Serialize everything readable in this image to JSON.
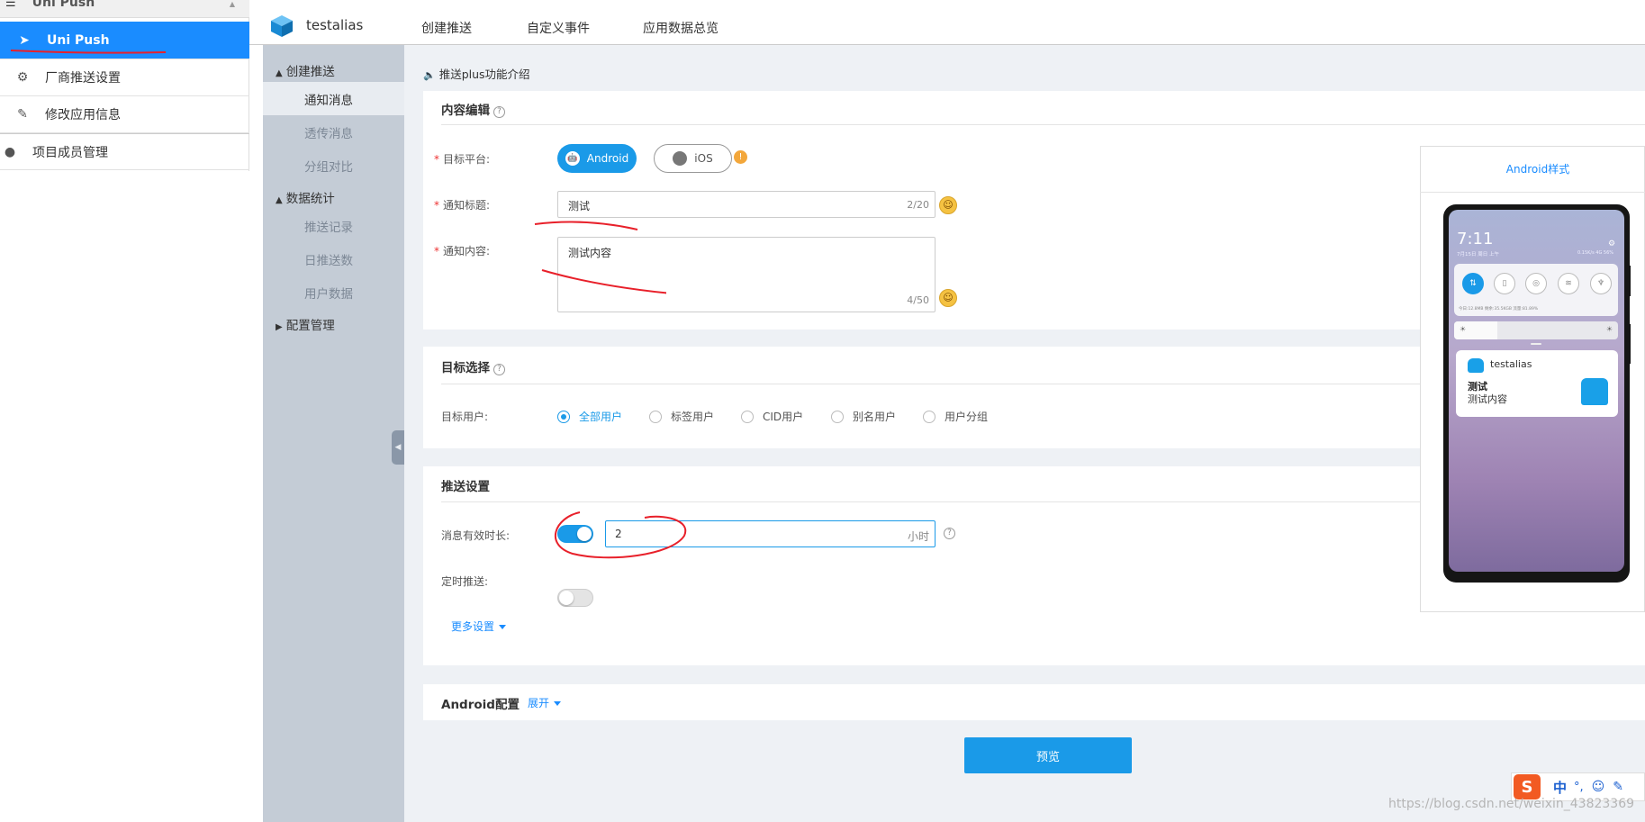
{
  "left_sidebar": {
    "header": "Uni Push",
    "items": [
      {
        "label": "Uni Push",
        "icon": "paper-plane-icon"
      },
      {
        "label": "厂商推送设置",
        "icon": "gear-icon"
      },
      {
        "label": "修改应用信息",
        "icon": "edit-icon"
      },
      {
        "label": "项目成员管理",
        "icon": "user-icon"
      }
    ]
  },
  "top_nav": {
    "app_name": "testalias",
    "links": [
      "创建推送",
      "自定义事件",
      "应用数据总览"
    ]
  },
  "sub_nav": {
    "groups": [
      {
        "label": "创建推送",
        "items": [
          "通知消息",
          "透传消息",
          "分组对比"
        ]
      },
      {
        "label": "数据统计",
        "items": [
          "推送记录",
          "日推送数",
          "用户数据"
        ]
      },
      {
        "label": "配置管理",
        "items": []
      }
    ]
  },
  "intro_link": "推送plus功能介绍",
  "content_section": {
    "title": "内容编辑",
    "platform_label": "目标平台:",
    "platform_android": "Android",
    "platform_ios": "iOS",
    "notif_title_label": "通知标题:",
    "notif_title_value": "测试",
    "notif_title_count": "2/20",
    "notif_content_label": "通知内容:",
    "notif_content_value": "测试内容",
    "notif_content_count": "4/50"
  },
  "target_section": {
    "title": "目标选择",
    "label": "目标用户:",
    "options": [
      "全部用户",
      "标签用户",
      "CID用户",
      "别名用户",
      "用户分组"
    ],
    "selected": "全部用户"
  },
  "push_settings": {
    "title": "推送设置",
    "validity_label": "消息有效时长:",
    "validity_value": "2",
    "validity_unit": "小时",
    "validity_enabled": true,
    "schedule_label": "定时推送:",
    "schedule_enabled": false,
    "more": "更多设置"
  },
  "android_config": {
    "title": "Android配置",
    "expand": "展开"
  },
  "preview_button": "预览",
  "preview_panel": {
    "title": "Android样式",
    "time": "7:11",
    "date": "7月15日 周日 上午",
    "status": "0.15K/s 4G 56%",
    "qs_footer": "今日:12.8MB  剩余:35.5KGB          流量:81.89%",
    "notif_app": "testalias",
    "notif_title": "测试",
    "notif_content": "测试内容"
  },
  "ime": {
    "mode": "中",
    "punct": "°,"
  },
  "watermark": "https://blog.csdn.net/weixin_43823369",
  "colors": {
    "primary": "#1a9ae8",
    "active_nav": "#1a8cff",
    "annotation": "#e8202a"
  }
}
